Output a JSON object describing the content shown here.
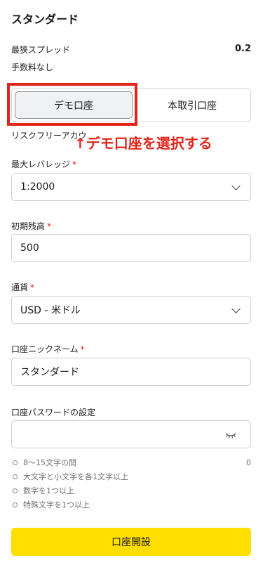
{
  "header": {
    "title": "スタンダード"
  },
  "stats": [
    {
      "label": "最狭スプレッド",
      "value": "0.2"
    },
    {
      "label": "手数料なし",
      "value": ""
    }
  ],
  "account_type": {
    "demo_label": "デモ口座",
    "real_label": "本取引口座",
    "selected": "デモ口座"
  },
  "risk_text": "リスクフリーアカウ",
  "annotation": "↑デモ口座を選択する",
  "annotation_color": "#e1251b",
  "leverage": {
    "label": "最大レバレッジ",
    "required_mark": "*",
    "value": "1:2000"
  },
  "initial_balance": {
    "label": "初期残高",
    "required_mark": "*",
    "value": "500"
  },
  "currency": {
    "label": "通貨",
    "required_mark": "*",
    "value": "USD - 米ドル"
  },
  "nickname": {
    "label": "口座ニックネーム",
    "required_mark": "*",
    "value": "スタンダード"
  },
  "password": {
    "label": "口座パスワードの設定",
    "value": "",
    "icon": "eye-closed-icon",
    "rules": [
      {
        "text": "8～15文字の間",
        "count": "0"
      },
      {
        "text": "大文字と小文字を各1文字以上",
        "count": ""
      },
      {
        "text": "数字を1つ以上",
        "count": ""
      },
      {
        "text": "特殊文字を1つ以上",
        "count": ""
      }
    ]
  },
  "submit_label": "口座開設",
  "accent_color": "#ffde00"
}
